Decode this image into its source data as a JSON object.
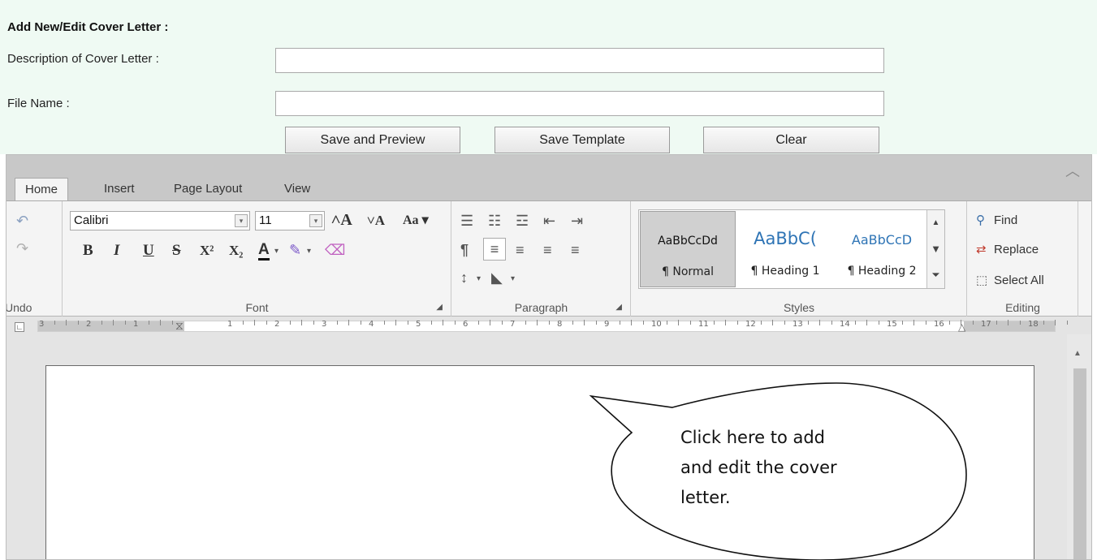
{
  "form": {
    "title": "Add New/Edit Cover Letter :",
    "description_label": "Description of Cover Letter :",
    "description_value": "",
    "filename_label": "File Name :",
    "filename_value": "",
    "buttons": {
      "save_preview": "Save and Preview",
      "save_template": "Save Template",
      "clear": "Clear"
    }
  },
  "ribbon": {
    "tabs": [
      "Home",
      "Insert",
      "Page Layout",
      "View"
    ],
    "active_tab": "Home",
    "groups": {
      "undo": "Undo",
      "font": "Font",
      "paragraph": "Paragraph",
      "styles": "Styles",
      "editing": "Editing"
    },
    "font_name": "Calibri",
    "font_size": "11",
    "font_buttons": {
      "grow": "A",
      "shrink": "A",
      "case": "Aa",
      "bold": "B",
      "italic": "I",
      "underline": "U",
      "strike": "S",
      "superscript": "X²",
      "subscript": "X₂",
      "font_color": "A"
    },
    "styles": [
      {
        "sample": "AaBbCcDd",
        "name": "¶ Normal"
      },
      {
        "sample": "AaBbC(",
        "name": "¶ Heading 1"
      },
      {
        "sample": "AaBbCcD",
        "name": "¶ Heading 2"
      }
    ],
    "editing": {
      "find": "Find",
      "replace": "Replace",
      "select_all": "Select All"
    }
  },
  "ruler": {
    "ticks": [
      "3",
      "2",
      "1",
      "1",
      "2",
      "3",
      "4",
      "5",
      "6",
      "7",
      "8",
      "9",
      "10",
      "11",
      "12",
      "13",
      "14",
      "15",
      "16",
      "17",
      "18"
    ]
  },
  "callout": {
    "line1": "Click here to add",
    "line2": "and edit the cover",
    "line3": "letter."
  },
  "colors": {
    "form_background": "#effaf3",
    "ribbon_background": "#f4f4f4",
    "tab_bar": "#c8c8c8",
    "selected_style": "#d0d0d0",
    "heading_blue": "#2e74b5"
  }
}
